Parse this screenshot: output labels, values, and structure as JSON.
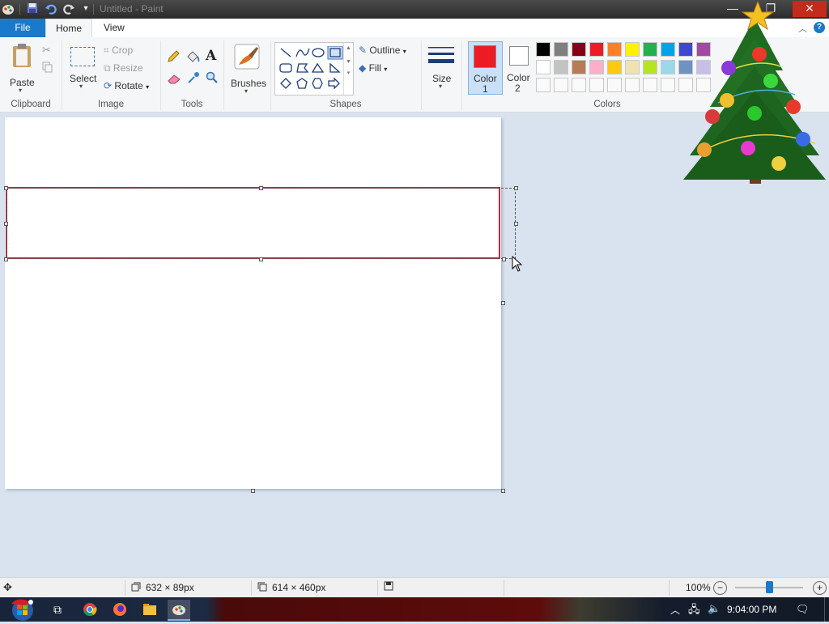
{
  "window": {
    "title": "Untitled - Paint"
  },
  "quick_access": {
    "icons": [
      "app-icon",
      "save-icon",
      "undo-icon",
      "redo-icon",
      "customize-icon"
    ]
  },
  "tabs": {
    "file": "File",
    "home": "Home",
    "view": "View"
  },
  "clipboard": {
    "paste": "Paste",
    "group": "Clipboard"
  },
  "image": {
    "select": "Select",
    "crop": "Crop",
    "resize": "Resize",
    "rotate": "Rotate",
    "group": "Image"
  },
  "tools": {
    "group": "Tools"
  },
  "brushes": {
    "label": "Brushes"
  },
  "shapes": {
    "outline": "Outline",
    "fill": "Fill",
    "group": "Shapes"
  },
  "size": {
    "label": "Size"
  },
  "colors": {
    "color1_label": "Color\n1",
    "color1_line1": "Color",
    "color1_line2": "1",
    "color2_line1": "Color",
    "color2_line2": "2",
    "color1_value": "#ed1c24",
    "color2_value": "#ffffff",
    "group": "Colors",
    "palette_row1": [
      "#000000",
      "#7f7f7f",
      "#880015",
      "#ed1c24",
      "#ff7f27",
      "#fff200",
      "#22b14c",
      "#00a2e8",
      "#3f48cc",
      "#a349a4"
    ],
    "palette_row2": [
      "#ffffff",
      "#c3c3c3",
      "#b97a57",
      "#ffaec9",
      "#ffc90e",
      "#efe4b0",
      "#b5e61d",
      "#99d9ea",
      "#7092be",
      "#c8bfe7"
    ]
  },
  "status": {
    "selection_size": "632 × 89px",
    "image_size": "614 × 460px",
    "zoom": "100%"
  },
  "taskbar": {
    "time": "9:04:00 PM"
  }
}
